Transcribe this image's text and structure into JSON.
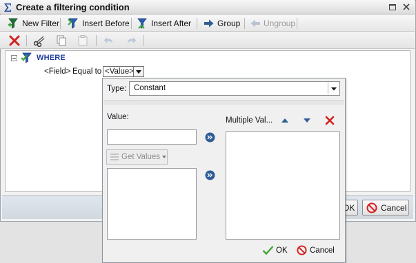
{
  "dialog": {
    "title": "Create a filtering condition"
  },
  "toolbar": {
    "new_filter": "New Filter",
    "insert_before": "Insert Before",
    "insert_after": "Insert After",
    "group": "Group",
    "ungroup": "Ungroup"
  },
  "tree": {
    "root": "WHERE",
    "condition": {
      "field": "<Field>",
      "operator": "Equal to",
      "value": "<Value>"
    }
  },
  "footer": {
    "ok": "OK",
    "cancel": "Cancel"
  },
  "popup": {
    "type_label": "Type:",
    "type_value": "Constant",
    "value_label": "Value:",
    "value_input": "",
    "get_values": "Get Values",
    "multiple_values_label": "Multiple Val...",
    "ok": "OK",
    "cancel": "Cancel"
  },
  "colors": {
    "accent_blue": "#1e3c9a",
    "delete_red": "#d42020",
    "ok_green": "#3fa535",
    "circle_blue": "#2f5d95"
  },
  "icons": {
    "new_filter": "filter-plus-icon",
    "insert_before": "filter-insert-before-icon",
    "insert_after": "filter-insert-after-icon",
    "group": "group-arrow-icon",
    "ungroup": "ungroup-arrow-icon",
    "delete": "delete-x-icon",
    "cut": "scissors-icon",
    "copy": "copy-icon",
    "paste": "paste-icon",
    "undo": "undo-icon",
    "redo": "redo-icon"
  }
}
